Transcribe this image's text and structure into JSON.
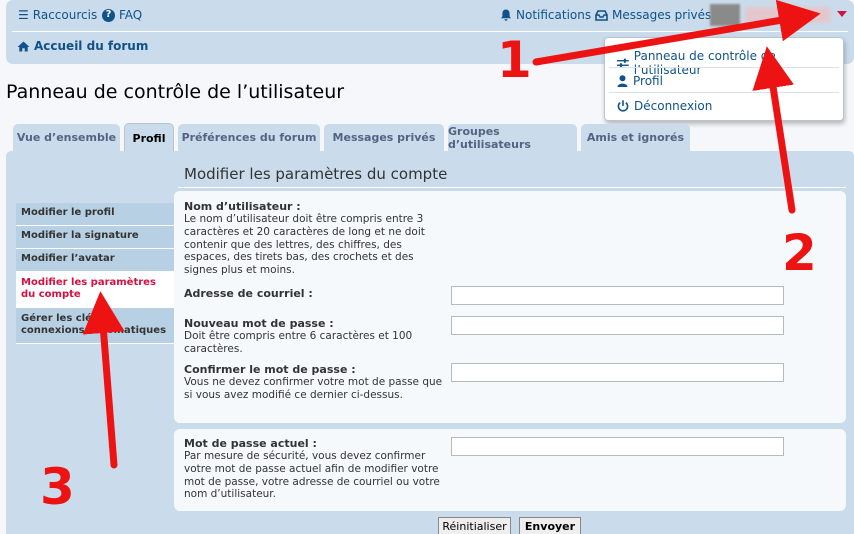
{
  "header": {
    "shortcuts_label": "Raccourcis",
    "faq_label": "FAQ",
    "notifications_label": "Notifications",
    "pm_label": "Messages privés",
    "breadcrumb_label": "Accueil du forum"
  },
  "user_menu": {
    "items": [
      {
        "label": "Panneau de contrôle de l’utilisateur",
        "icon": "sliders-icon"
      },
      {
        "label": "Profil",
        "icon": "user-icon"
      },
      {
        "label": "Déconnexion",
        "icon": "power-icon"
      }
    ]
  },
  "page": {
    "title": "Panneau de contrôle de l’utilisateur"
  },
  "tabs": [
    {
      "label": "Vue d’ensemble",
      "active": false
    },
    {
      "label": "Profil",
      "active": true
    },
    {
      "label": "Préférences du forum",
      "active": false
    },
    {
      "label": "Messages privés",
      "active": false
    },
    {
      "label": "Groupes d’utilisateurs",
      "active": false
    },
    {
      "label": "Amis et ignorés",
      "active": false
    }
  ],
  "side_menu": [
    {
      "label": "Modifier le profil",
      "active": false
    },
    {
      "label": "Modifier la signature",
      "active": false
    },
    {
      "label": "Modifier l’avatar",
      "active": false
    },
    {
      "label": "Modifier les paramètres du compte",
      "active": true
    },
    {
      "label": "Gérer les clés de connexions automatiques",
      "active": false
    }
  ],
  "form": {
    "heading": "Modifier les paramètres du compte",
    "username": {
      "label": "Nom d’utilisateur :",
      "desc": "Le nom d’utilisateur doit être compris entre 3 caractères et 20 caractères de long et ne doit contenir que des lettres, des chiffres, des espaces, des tirets bas, des crochets et des signes plus et moins."
    },
    "email": {
      "label": "Adresse de courriel :",
      "value": ""
    },
    "new_password": {
      "label": "Nouveau mot de passe :",
      "desc": "Doit être compris entre 6 caractères et 100 caractères.",
      "value": ""
    },
    "confirm_password": {
      "label": "Confirmer le mot de passe :",
      "desc": "Vous ne devez confirmer votre mot de passe que si vous avez modifié ce dernier ci-dessus.",
      "value": ""
    },
    "current_password": {
      "label": "Mot de passe actuel :",
      "desc": "Par mesure de sécurité, vous devez confirmer votre mot de passe actuel afin de modifier votre mot de passe, votre adresse de courriel ou votre nom d’utilisateur.",
      "value": ""
    },
    "reset_label": "Réinitialiser",
    "submit_label": "Envoyer"
  },
  "annotations": {
    "step1": "1",
    "step2": "2",
    "step3": "3",
    "color": "#ee1313"
  }
}
